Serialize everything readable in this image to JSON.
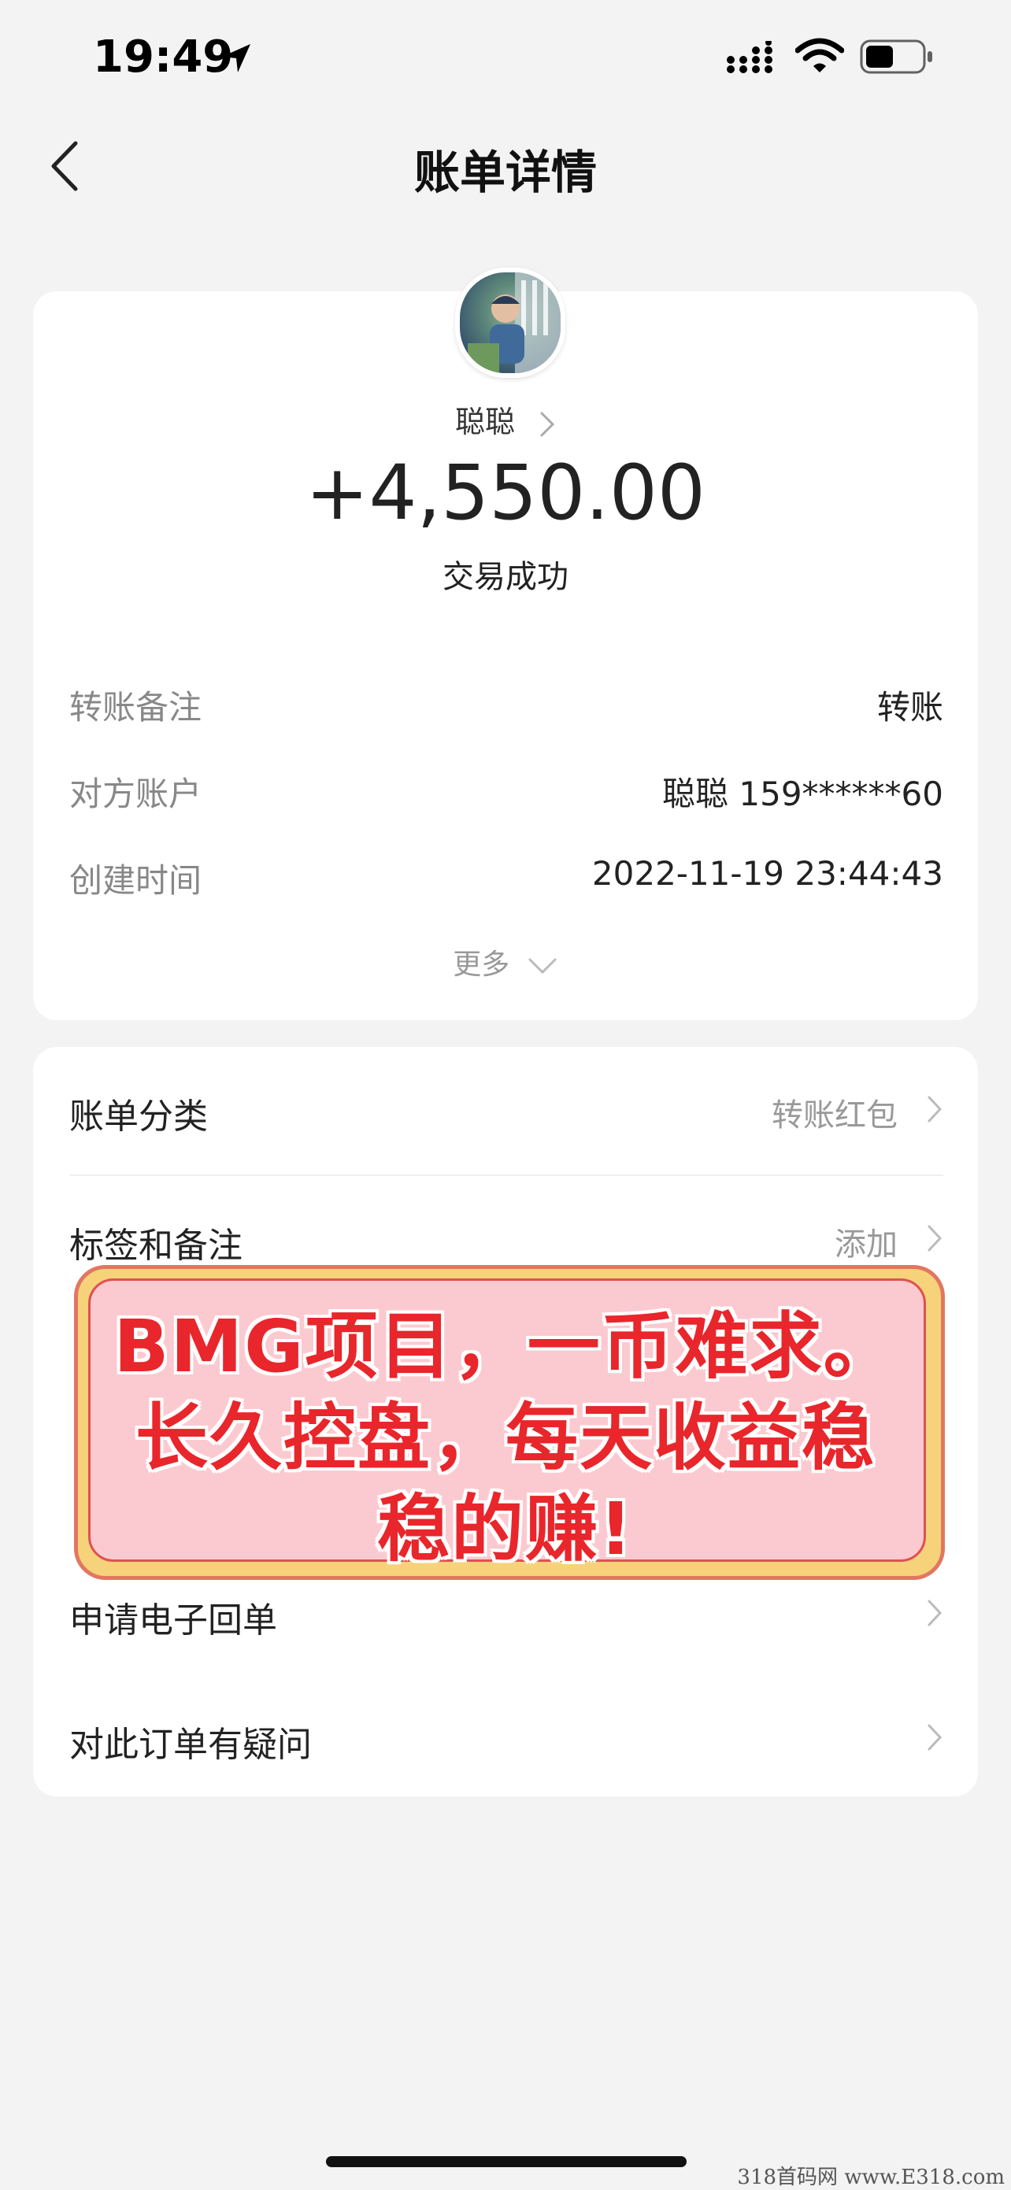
{
  "status_bar": {
    "time": "19:49"
  },
  "nav": {
    "title": "账单详情"
  },
  "transaction": {
    "payer": "聪聪",
    "amount": "+4,550.00",
    "status": "交易成功"
  },
  "details": [
    {
      "label": "转账备注",
      "value": "转账"
    },
    {
      "label": "对方账户",
      "value": "聪聪 159******60"
    },
    {
      "label": "创建时间",
      "value": "2022-11-19 23:44:43"
    }
  ],
  "more_label": "更多",
  "menu": [
    {
      "label": "账单分类",
      "value": "转账红包"
    },
    {
      "label": "标签和备注",
      "value": "添加"
    },
    {
      "label": "申请电子回单",
      "value": ""
    },
    {
      "label": "对此订单有疑问",
      "value": ""
    }
  ],
  "promo": {
    "lines": [
      "BMG项目，一币难求。",
      "长久控盘，每天收益稳",
      "稳的赚!"
    ]
  },
  "watermark": "318首码网 www.E318.com",
  "colors": {
    "promo_text": "#e8262b",
    "promo_bg": "#fbcad0",
    "promo_border": "#f6d27a"
  }
}
